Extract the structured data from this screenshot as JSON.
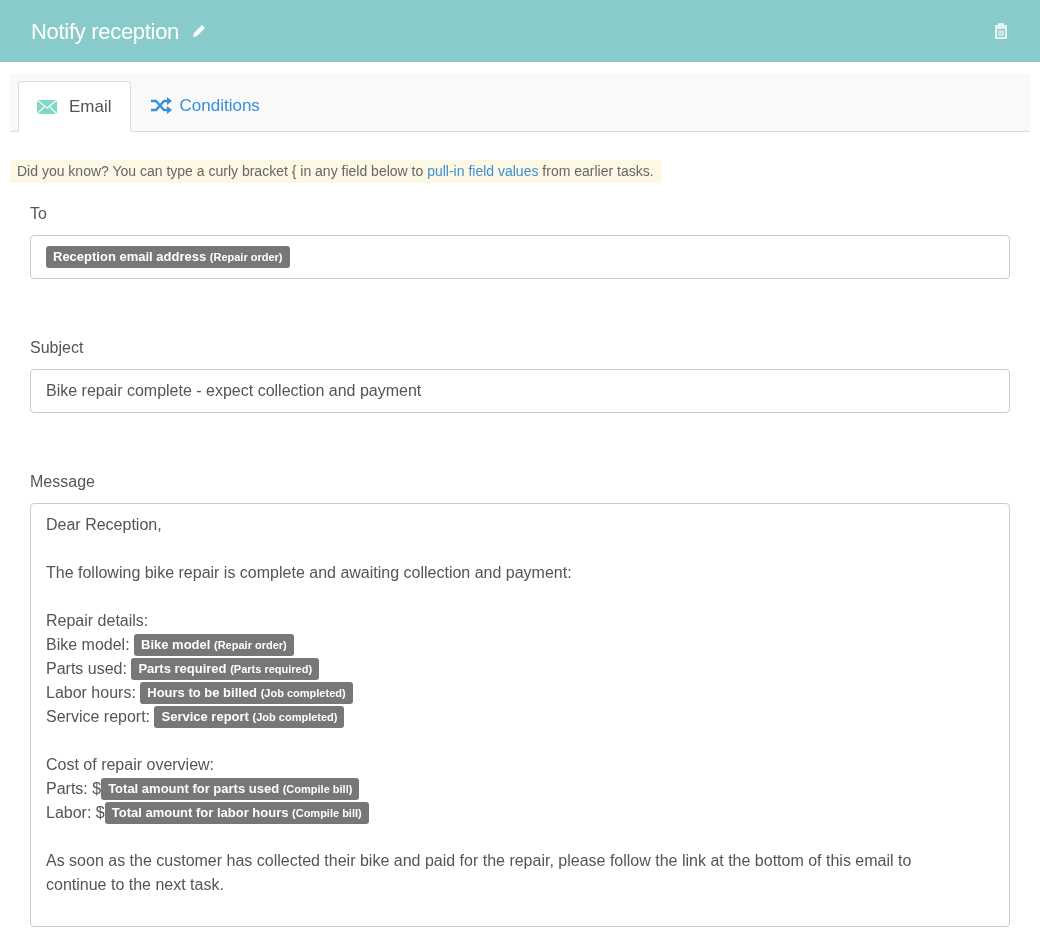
{
  "header": {
    "title": "Notify reception"
  },
  "tabs": [
    {
      "label": "Email",
      "kind": "email",
      "selected": true
    },
    {
      "label": "Conditions",
      "kind": "conditions",
      "selected": false
    }
  ],
  "tip": {
    "text": "Did you know? You can type a curly bracket { in any field below to",
    "link": "pull-in field values",
    "after": "from earlier tasks."
  },
  "to": {
    "label": "To",
    "tokens": [
      {
        "field": "Reception email address",
        "source": "(Repair order)"
      }
    ]
  },
  "subject": {
    "label": "Subject",
    "value": "Bike repair complete - expect collection and payment"
  },
  "message": {
    "label": "Message",
    "paragraphs": [
      {
        "lines": [
          [
            {
              "kind": "text",
              "text": "Dear Reception,"
            }
          ]
        ]
      },
      {
        "lines": [
          [
            {
              "kind": "text",
              "text": "The following bike repair is complete and awaiting collection and payment:"
            }
          ]
        ]
      },
      {
        "lines": [
          [
            {
              "kind": "text",
              "text": "Repair details:"
            }
          ],
          [
            {
              "kind": "text",
              "text": "Bike model: "
            },
            {
              "kind": "token",
              "field": "Bike model",
              "source": "(Repair order)"
            }
          ],
          [
            {
              "kind": "text",
              "text": "Parts used: "
            },
            {
              "kind": "token",
              "field": "Parts required",
              "source": "(Parts required)"
            }
          ],
          [
            {
              "kind": "text",
              "text": "Labor hours: "
            },
            {
              "kind": "token",
              "field": "Hours to be billed",
              "source": "(Job completed)"
            }
          ],
          [
            {
              "kind": "text",
              "text": "Service report: "
            },
            {
              "kind": "token",
              "field": "Service report",
              "source": "(Job completed)"
            }
          ]
        ]
      },
      {
        "lines": [
          [
            {
              "kind": "text",
              "text": "Cost of repair overview:"
            }
          ],
          [
            {
              "kind": "text",
              "text": "Parts: $"
            },
            {
              "kind": "token",
              "field": "Total amount for parts used",
              "source": "(Compile bill)"
            }
          ],
          [
            {
              "kind": "text",
              "text": "Labor: $"
            },
            {
              "kind": "token",
              "field": "Total amount for labor hours",
              "source": "(Compile bill)"
            }
          ]
        ]
      },
      {
        "lines": [
          [
            {
              "kind": "text",
              "text": "As soon as the customer has collected their bike and paid for the repair, please follow the link at the bottom of this email to continue to the next task."
            }
          ]
        ]
      }
    ]
  }
}
